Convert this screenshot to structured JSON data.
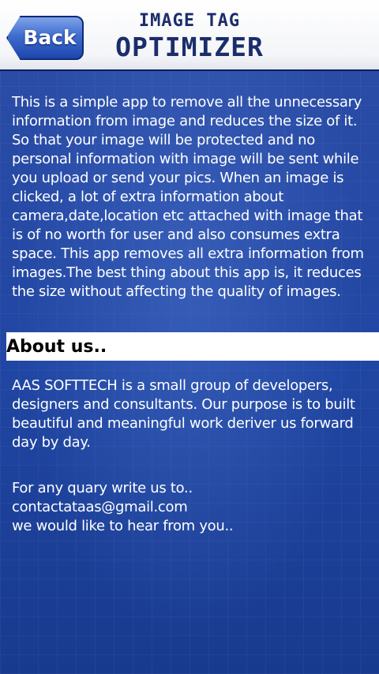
{
  "header": {
    "back_label": "Back",
    "title_line1": "IMAGE TAG",
    "title_line2": "OPTIMIZER"
  },
  "description": "This is a simple app to remove all the unnecessary information from image and reduces the size of it. So that your image will be protected and no personal information with image will be sent while you upload or send your pics. When an image is clicked, a lot of extra information about camera,date,location etc attached with image that is of no worth for user and also consumes extra space. This app removes all extra information from images.The best thing about this app is, it reduces the size without affecting the quality of images.",
  "about": {
    "heading": "About us..",
    "text": "AAS SOFTTECH is a small group of developers, designers and consultants. Our purpose is to built beautiful and meaningful work deriver us forward day by day."
  },
  "contact": {
    "line1": "For any quary write us to..",
    "email": "contactataas@gmail.com",
    "line3": "we would like to hear from you.."
  },
  "colors": {
    "background": "#1b3d97",
    "header": "#ffffff",
    "title": "#1b2d6b",
    "button": "#3f6dcf"
  }
}
